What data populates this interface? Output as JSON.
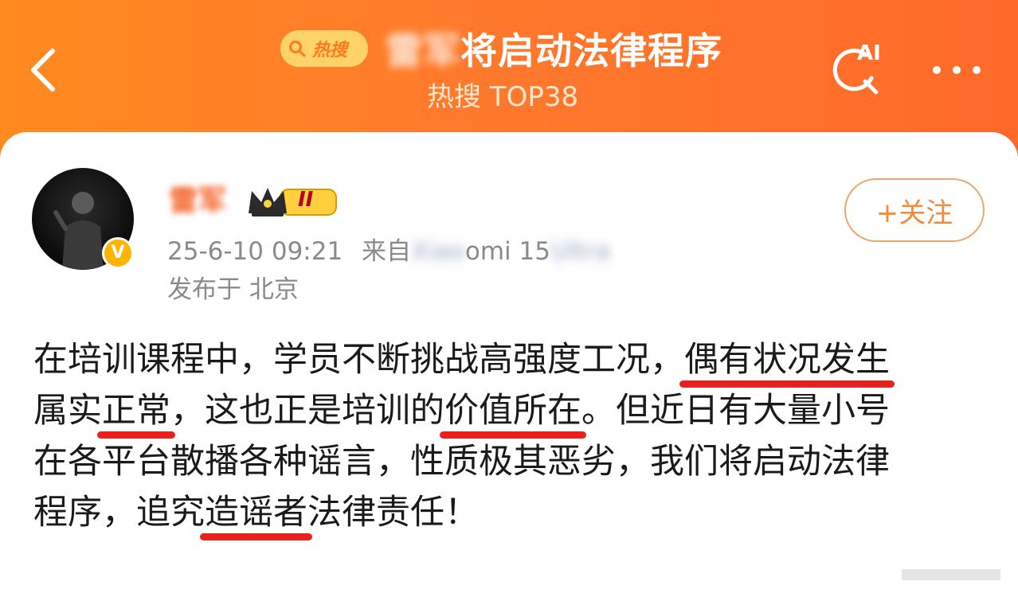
{
  "header": {
    "hot_badge_label": "热搜",
    "title_blurred": "雷军",
    "title_rest": "将启动法律程序",
    "subtitle": "热搜 TOP38",
    "ai_label": "AI",
    "colors": {
      "bg_start": "#ff8a1f",
      "bg_end": "#ff6a2a",
      "badge": "#ffd36a"
    }
  },
  "post": {
    "author_name": "雷军",
    "verified_mark": "V",
    "rank_label": "II",
    "follow_label": "+关注",
    "time": "25-6-10 09:21",
    "source_prefix": "来自",
    "source_visible": "omi 15",
    "location": "发布于 北京",
    "lines": [
      [
        "在培训课程中，学员不断挑战高强度工况，",
        "偶有状况发生"
      ],
      [
        "属实",
        "正常",
        "，这也正是培训的",
        "价值所在",
        "。但近日有大量小号"
      ],
      [
        "在各平台散播各种谣言，性质极其恶劣，我们将启动法律"
      ],
      [
        "程序，追究",
        "造谣者",
        "法律责任！"
      ]
    ],
    "underline_color": "#e9201e"
  }
}
